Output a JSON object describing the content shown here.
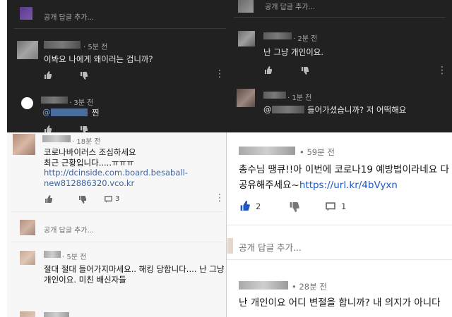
{
  "top_left": {
    "reply_placeholder": "공개 답글 추가...",
    "comment1": {
      "time": "5분 전",
      "text": "이봐요 나에게 왜이러는 겁니까?"
    },
    "comment2": {
      "time": "3분 전",
      "mention": "@",
      "text": "찐"
    }
  },
  "top_right": {
    "reply_placeholder": "공개 답글 추가...",
    "comment1": {
      "time": "2분 전",
      "text": "난 그냥 개인이요."
    },
    "comment2": {
      "time": "1분 전",
      "mention": "@",
      "text": "들어가셨습니까? 저 어떡해요"
    }
  },
  "bottom_left": {
    "comment1": {
      "time": "18분 전",
      "line1": "코로나바이러스 조심하세요",
      "line2": "최근 근황입니다.....ㅠㅠㅠ",
      "link1": "http://dcinside.com.board.besaball-",
      "link2": "new812886320.vco.kr",
      "reply_count": "3"
    },
    "reply_placeholder": "공개 답글 추가...",
    "comment2": {
      "time": "5분 전",
      "line1": "절대 절대 들어가지마세요.. 해킹 당합니다.... 난 그냥",
      "line2": "개인이요.  미친 배신자들"
    }
  },
  "bottom_right": {
    "comment1": {
      "time": "59분 전",
      "text": "총수님 땡큐!!아 이번에 코로나19  예방법이라네요 다",
      "text2": "공유해주세요~",
      "link": "https://url.kr/4bVyxn",
      "like_count": "2",
      "reply_count": "1"
    },
    "reply_placeholder": "공개 답글 추가...",
    "comment2": {
      "time": "28분 전",
      "text": "난 개인이요 어디 변절을 합니까? 내 의지가 아니다"
    }
  },
  "icons": {
    "like": "thumbs-up-icon",
    "dislike": "thumbs-down-icon",
    "reply": "comment-icon",
    "more": "more-vertical-icon"
  },
  "colors": {
    "dark_bg": "#212121",
    "light_bg": "#f7f7f7",
    "link": "#3b63a3",
    "accent_like": "#1f57c3"
  }
}
